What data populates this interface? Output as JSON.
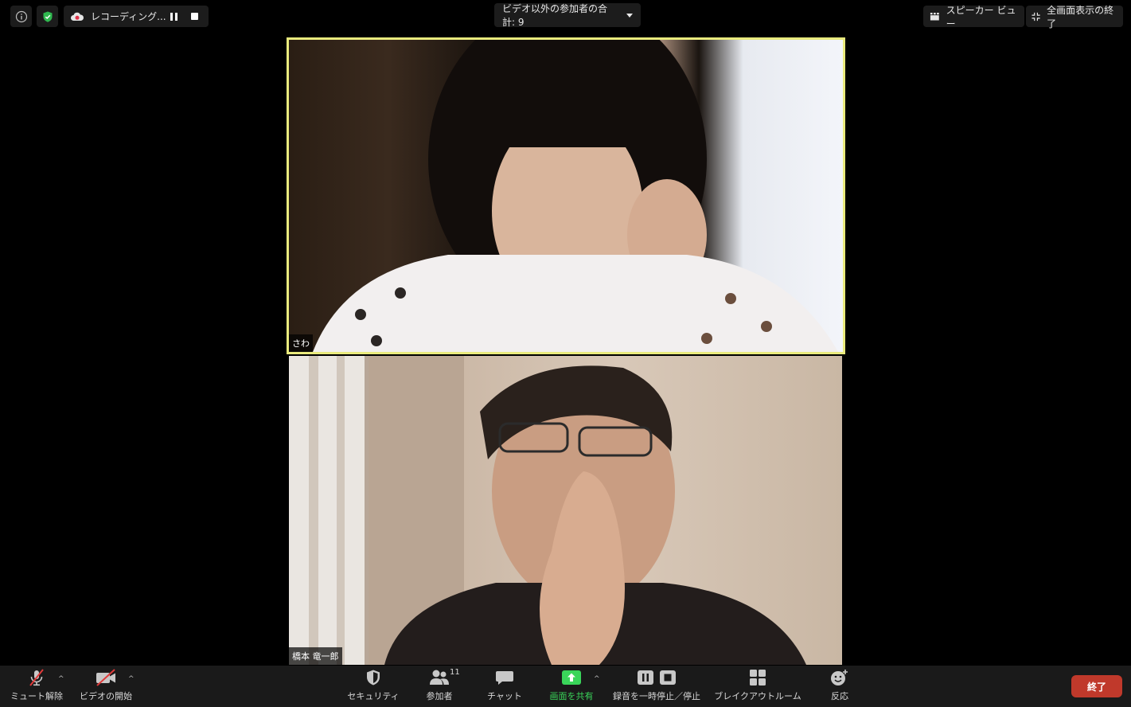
{
  "top_bar": {
    "recording_label": "レコーディング...",
    "participants_label": "ビデオ以外の参加者の合計: 9",
    "speaker_view_label": "スピーカー ビュー",
    "exit_fullscreen_label": "全画面表示の終了"
  },
  "participants": [
    {
      "name": "さわ",
      "active_speaker": true
    },
    {
      "name": "橋本 竜一郎",
      "active_speaker": false
    }
  ],
  "toolbar": {
    "unmute_label": "ミュート解除",
    "start_video_label": "ビデオの開始",
    "security_label": "セキュリティ",
    "participants_label": "参加者",
    "participants_count": "11",
    "chat_label": "チャット",
    "share_screen_label": "画面を共有",
    "recording_control_label": "録音を一時停止／停止",
    "breakout_label": "ブレイクアウトルーム",
    "reactions_label": "反応",
    "end_label": "終了"
  },
  "colors": {
    "active_speaker_border": "#e9ea7d",
    "share_green": "#3ad55a",
    "end_red": "#c0392b",
    "shield_green": "#2fb84f"
  }
}
